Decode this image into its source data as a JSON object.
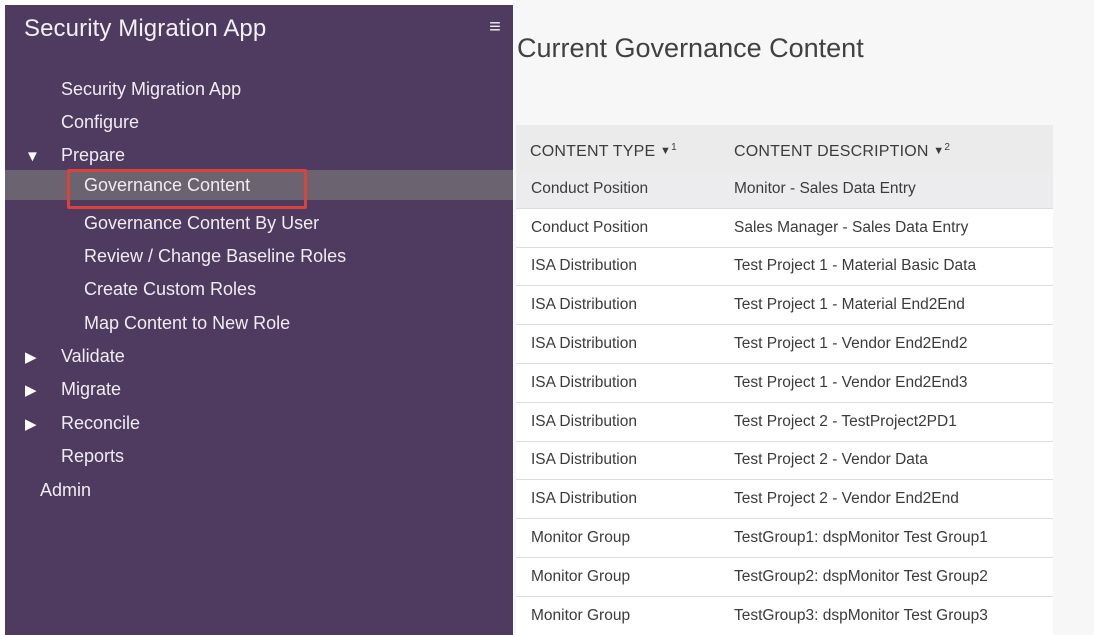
{
  "sidebar": {
    "app_title": "Security Migration App",
    "menu_icon": "hamburger-menu-icon",
    "items": [
      {
        "label": "Security Migration App",
        "level": 1
      },
      {
        "label": "Configure",
        "level": 1
      },
      {
        "label": "Prepare",
        "level": 1,
        "expander": "▼",
        "expanded": true
      },
      {
        "label": "Governance Content",
        "level": 2,
        "active": true
      },
      {
        "label": "Governance Content By User",
        "level": 2
      },
      {
        "label": "Review / Change Baseline Roles",
        "level": 2
      },
      {
        "label": "Create Custom Roles",
        "level": 2
      },
      {
        "label": "Map Content to New Role",
        "level": 2
      },
      {
        "label": "Validate",
        "level": 1,
        "expander": "▶",
        "expanded": false
      },
      {
        "label": "Migrate",
        "level": 1,
        "expander": "▶",
        "expanded": false
      },
      {
        "label": "Reconcile",
        "level": 1,
        "expander": "▶",
        "expanded": false
      },
      {
        "label": "Reports",
        "level": 1
      },
      {
        "label": "Admin",
        "level": 0
      }
    ],
    "active_highlight_color": "#d9443a"
  },
  "main": {
    "title": "Current Governance Content",
    "table": {
      "columns": [
        {
          "label": "CONTENT TYPE",
          "sort_icon": "▼",
          "sort_order": "1"
        },
        {
          "label": "CONTENT DESCRIPTION",
          "sort_icon": "▼",
          "sort_order": "2"
        }
      ],
      "rows": [
        [
          "Conduct Position",
          "Monitor - Sales Data Entry"
        ],
        [
          "Conduct Position",
          "Sales Manager - Sales Data Entry"
        ],
        [
          "ISA Distribution",
          "Test Project 1 - Material Basic Data"
        ],
        [
          "ISA Distribution",
          "Test Project 1 - Material End2End"
        ],
        [
          "ISA Distribution",
          "Test Project 1 - Vendor End2End2"
        ],
        [
          "ISA Distribution",
          "Test Project 1 - Vendor End2End3"
        ],
        [
          "ISA Distribution",
          "Test Project 2 - TestProject2PD1"
        ],
        [
          "ISA Distribution",
          "Test Project 2 - Vendor Data"
        ],
        [
          "ISA Distribution",
          "Test Project 2 - Vendor End2End"
        ],
        [
          "Monitor Group",
          "TestGroup1: dspMonitor Test Group1"
        ],
        [
          "Monitor Group",
          "TestGroup2: dspMonitor Test Group2"
        ],
        [
          "Monitor Group",
          "TestGroup3: dspMonitor Test Group3"
        ]
      ],
      "selected_row": 0
    }
  },
  "colors": {
    "sidebar_bg": "#4f3b5f",
    "active_row_bg": "#6b6470",
    "highlight_border": "#d9443a",
    "header_bg": "#ebebeb"
  }
}
